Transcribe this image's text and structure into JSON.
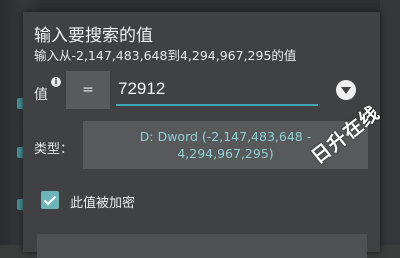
{
  "dialog": {
    "title": "输入要搜索的值",
    "subtitle": "输入从-2,147,483,648到4,294,967,295的值",
    "value_label": "值",
    "info_icon": "info-icon",
    "operator": "=",
    "value": "72912",
    "dropdown_icon": "chevron-down-icon",
    "type_label": "类型：",
    "type_line1": "D: Dword (-2,147,483,648 -",
    "type_line2": "4,294,967,295)",
    "encrypted_label": "此值被加密",
    "encrypted_checked": true
  },
  "watermark": "日升在线",
  "colors": {
    "accent": "#3ea7b3",
    "checkbox": "#6fb4bb",
    "dialog_bg": "#3f4142"
  }
}
